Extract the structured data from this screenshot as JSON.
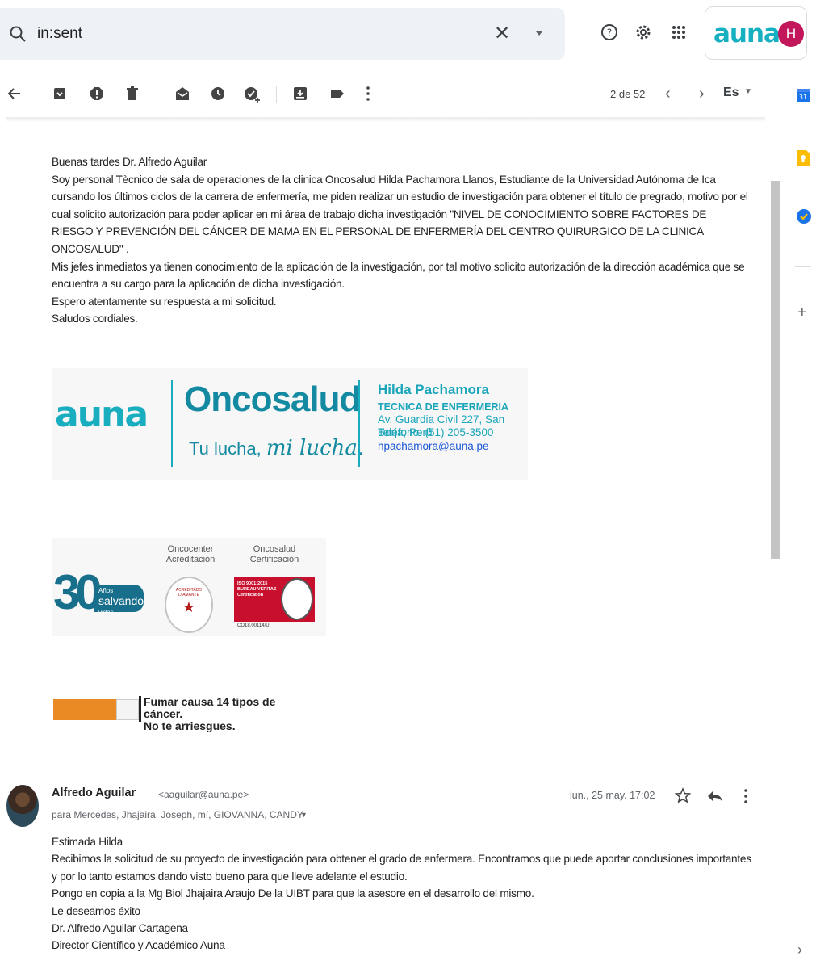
{
  "search": {
    "query": "in:sent"
  },
  "account": {
    "brand": "auna",
    "avatar_letter": "H",
    "avatar_color": "#c2185b"
  },
  "toolbar": {
    "icons": [
      "back-arrow-icon",
      "archive-icon",
      "report-spam-icon",
      "delete-icon",
      "mark-unread-icon",
      "snooze-icon",
      "add-task-icon",
      "move-to-icon",
      "label-icon",
      "more-vert-icon"
    ],
    "pager": "2 de 52",
    "language": "Es"
  },
  "rail": {
    "calendar_day": "31"
  },
  "email1": {
    "lines": [
      "Buenas tardes Dr. Alfredo Aguilar",
      "Soy personal Tècnico de sala de operaciones de la clinica Oncosalud Hilda Pachamora Llanos, Estudiante de la Universidad Autónoma de Ica",
      "cursando los últimos ciclos de la carrera de enfermería, me piden realizar un estudio de investigación para obtener el título de pregrado, motivo por el",
      "cual solicito autorización para poder aplicar en mi área de trabajo dicha investigación \"NIVEL DE CONOCIMIENTO SOBRE FACTORES DE",
      "RIESGO Y PREVENCIÓN DEL CÁNCER DE MAMA EN EL PERSONAL DE ENFERMERÍA DEL CENTRO QUIRURGICO DE LA CLINICA",
      "ONCOSALUD\" .",
      "Mis jefes inmediatos ya tienen conocimiento de la aplicación de la investigación, por tal motivo solicito autorización de la dirección académica que se",
      "encuentra a su cargo para la aplicación de dicha investigación.",
      "Espero atentamente su respuesta a mi solicitud.",
      "Saludos cordiales."
    ],
    "signature": {
      "brand": "auna",
      "company": "Oncosalud",
      "tagline_prefix": "Tu lucha,",
      "tagline_script": "mi lucha.",
      "name": "Hilda Pachamora",
      "role": "TECNICA DE ENFERMERIA",
      "address": "Av. Guardia Civil 227, San Borja, Perú",
      "phone": "Teléfono: (51) 205-3500",
      "email": "hpachamora@auna.pe"
    },
    "badges": {
      "years": "30",
      "anos": "Años",
      "salvando": "salvando",
      "vidas": "vidas",
      "oncocenter_label_1": "Oncocenter",
      "oncocenter_label_2": "Acreditación",
      "oncosalud_label_1": "Oncosalud",
      "oncosalud_label_2": "Certificación",
      "seal_top": "ACREDITADO",
      "seal_level": "DIAMANTE",
      "iso_line_1": "ISO 9001:2015",
      "iso_line_2": "BUREAU VERITAS",
      "iso_line_3": "Certification",
      "iso_code": "CO18.00114/U"
    },
    "smoking_warning": {
      "line1": "Fumar causa 14 tipos de cáncer.",
      "line2": "No te arriesgues."
    }
  },
  "email2": {
    "sender_name": "Alfredo Aguilar",
    "sender_email": "<aaguilar@auna.pe>",
    "recipients": "para Mercedes, Jhajaira, Joseph, mí, GIOVANNA, CANDY",
    "date": "lun., 25 may. 17:02",
    "lines": [
      "Estimada Hilda",
      "Recibimos la solicitud de su proyecto de investigación para obtener el grado de enfermera. Encontramos que puede aportar conclusiones importantes",
      "y por lo tanto estamos dando visto bueno para que lleve adelante el estudio.",
      "Pongo en copia a la Mg Biol Jhajaira Araujo De la UIBT  para que la asesore en el desarrollo del mismo.",
      "Le deseamos éxito",
      "Dr. Alfredo Aguilar Cartagena",
      "Director Científico y Académico Auna"
    ]
  }
}
